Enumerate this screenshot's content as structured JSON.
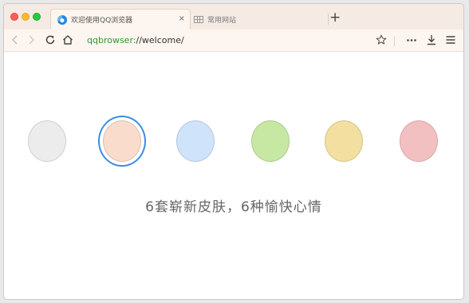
{
  "tabs": [
    {
      "title": "欢迎使用QQ浏览器",
      "icon": "qq-browser-icon",
      "active": true,
      "close_label": "×"
    },
    {
      "title": "常用网站",
      "icon": "grid-icon",
      "active": false
    }
  ],
  "new_tab_label": "+",
  "address_bar": {
    "scheme": "qqbrowser:",
    "rest": "//welcome/"
  },
  "toolbar_icons": [
    "back-icon",
    "forward-icon",
    "reload-icon",
    "home-icon",
    "star-icon",
    "more-icon",
    "download-icon",
    "menu-icon"
  ],
  "skins": [
    {
      "name": "gray",
      "color": "#ececec",
      "selected": false
    },
    {
      "name": "peach",
      "color": "#f9dccb",
      "selected": true
    },
    {
      "name": "blue",
      "color": "#cfe3fb",
      "selected": false
    },
    {
      "name": "green",
      "color": "#c6e8a2",
      "selected": false
    },
    {
      "name": "yellow",
      "color": "#f3df9f",
      "selected": false
    },
    {
      "name": "pink",
      "color": "#f3c0c2",
      "selected": false
    }
  ],
  "accent_color": "#3b8de6",
  "tagline": "6套崭新皮肤，6种愉快心情"
}
